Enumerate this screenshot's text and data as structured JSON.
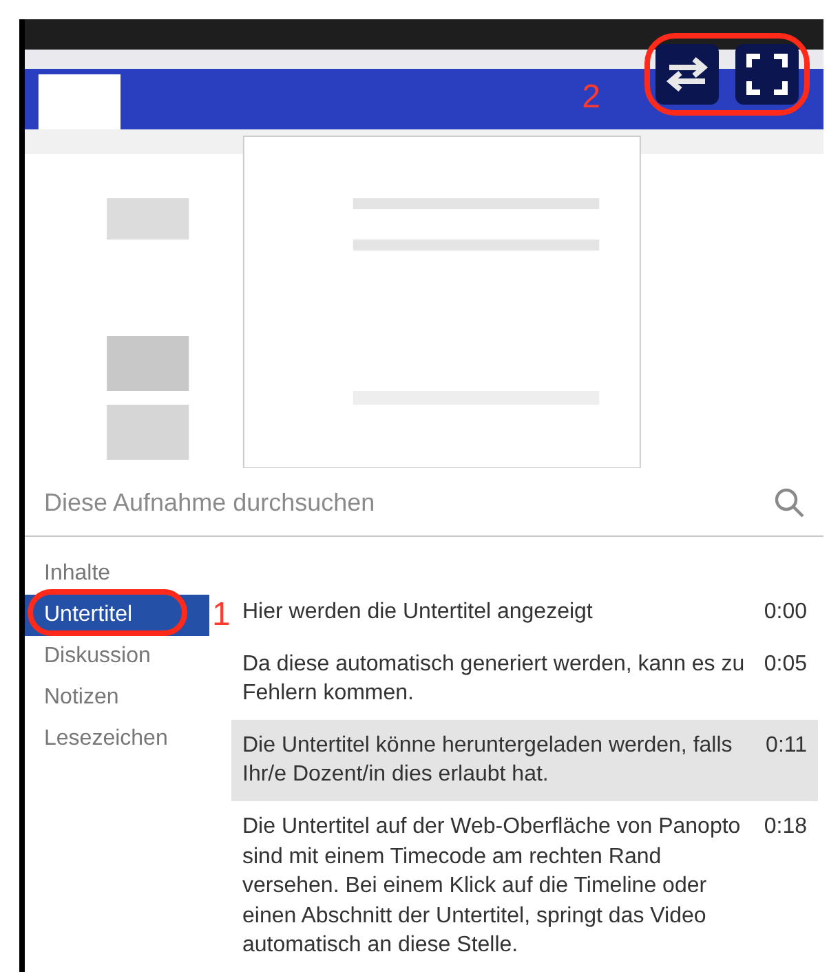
{
  "video": {
    "kind": "picture",
    "annotation": "2"
  },
  "search": {
    "placeholder": "Diese Aufnahme durchsuchen"
  },
  "tabs": [
    {
      "label": "Inhalte",
      "selected": false
    },
    {
      "label": "Untertitel",
      "selected": true
    },
    {
      "label": "Diskussion",
      "selected": false
    },
    {
      "label": "Notizen",
      "selected": false
    },
    {
      "label": "Lesezeichen",
      "selected": false
    }
  ],
  "tab_annotation": "1",
  "captions": [
    {
      "text": "Hier werden die Untertitel angezeigt",
      "time": "0:00",
      "selected": false
    },
    {
      "text": "Da diese automatisch generiert werden, kann es zu Fehlern kommen.",
      "time": "0:05",
      "selected": false
    },
    {
      "text": "Die Untertitel könne heruntergeladen werden, falls Ihr/e Dozent/in dies erlaubt hat.",
      "time": "0:11",
      "selected": true
    },
    {
      "text": "Die Untertitel auf der Web-Oberfläche von Panopto sind mit einem Timecode am rechten Rand versehen. Bei einem Klick auf die Timeline oder einen Abschnitt der Untertitel, springt das Video automatisch an diese Stelle.",
      "time": "0:18",
      "selected": false
    }
  ]
}
